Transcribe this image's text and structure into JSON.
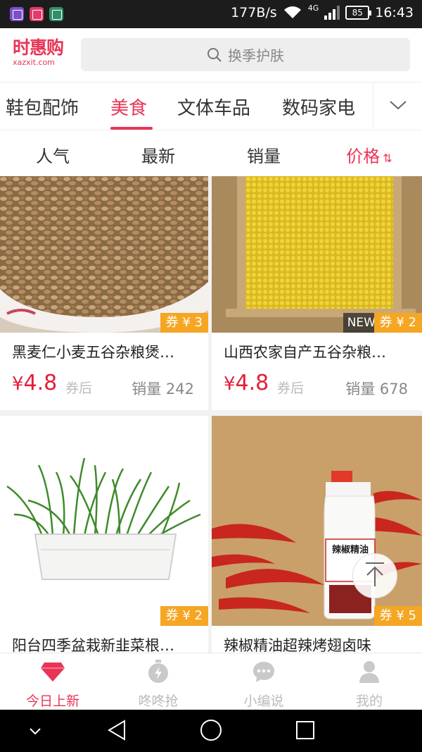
{
  "status_bar": {
    "speed": "177B/s",
    "network": "4G",
    "battery": "85",
    "time": "16:43"
  },
  "header": {
    "logo_text": "时惠购",
    "logo_domain": "xazxit.com",
    "search_placeholder": "换季护肤"
  },
  "categories": {
    "items": [
      "鞋包配饰",
      "美食",
      "文体车品",
      "数码家电"
    ],
    "active": "美食"
  },
  "sort_options": {
    "items": [
      "人气",
      "最新",
      "销量",
      "价格"
    ],
    "active": "价格"
  },
  "products": [
    {
      "title": "黑麦仁小麦五谷杂粮煲…",
      "price": "4.8",
      "currency": "¥",
      "price_note": "券后",
      "sales": "销量 242",
      "coupon": "券 ¥ 3",
      "new": false
    },
    {
      "title": "山西农家自产五谷杂粮…",
      "price": "4.8",
      "currency": "¥",
      "price_note": "券后",
      "sales": "销量 678",
      "coupon": "券 ¥ 2",
      "new": true,
      "new_label": "NEW"
    },
    {
      "title": "阳台四季盆栽新韭菜根…",
      "coupon": "券 ¥ 2",
      "new": false
    },
    {
      "title": "辣椒精油超辣烤翅卤味",
      "coupon": "券 ¥ 5",
      "new": false,
      "bottle_label": "辣椒精油"
    }
  ],
  "bottom_tabs": {
    "items": [
      "今日上新",
      "咚咚抢",
      "小编说",
      "我的"
    ],
    "active": "今日上新"
  },
  "colors": {
    "accent": "#e83556",
    "price": "#e41d3a",
    "coupon": "#f5a623"
  }
}
